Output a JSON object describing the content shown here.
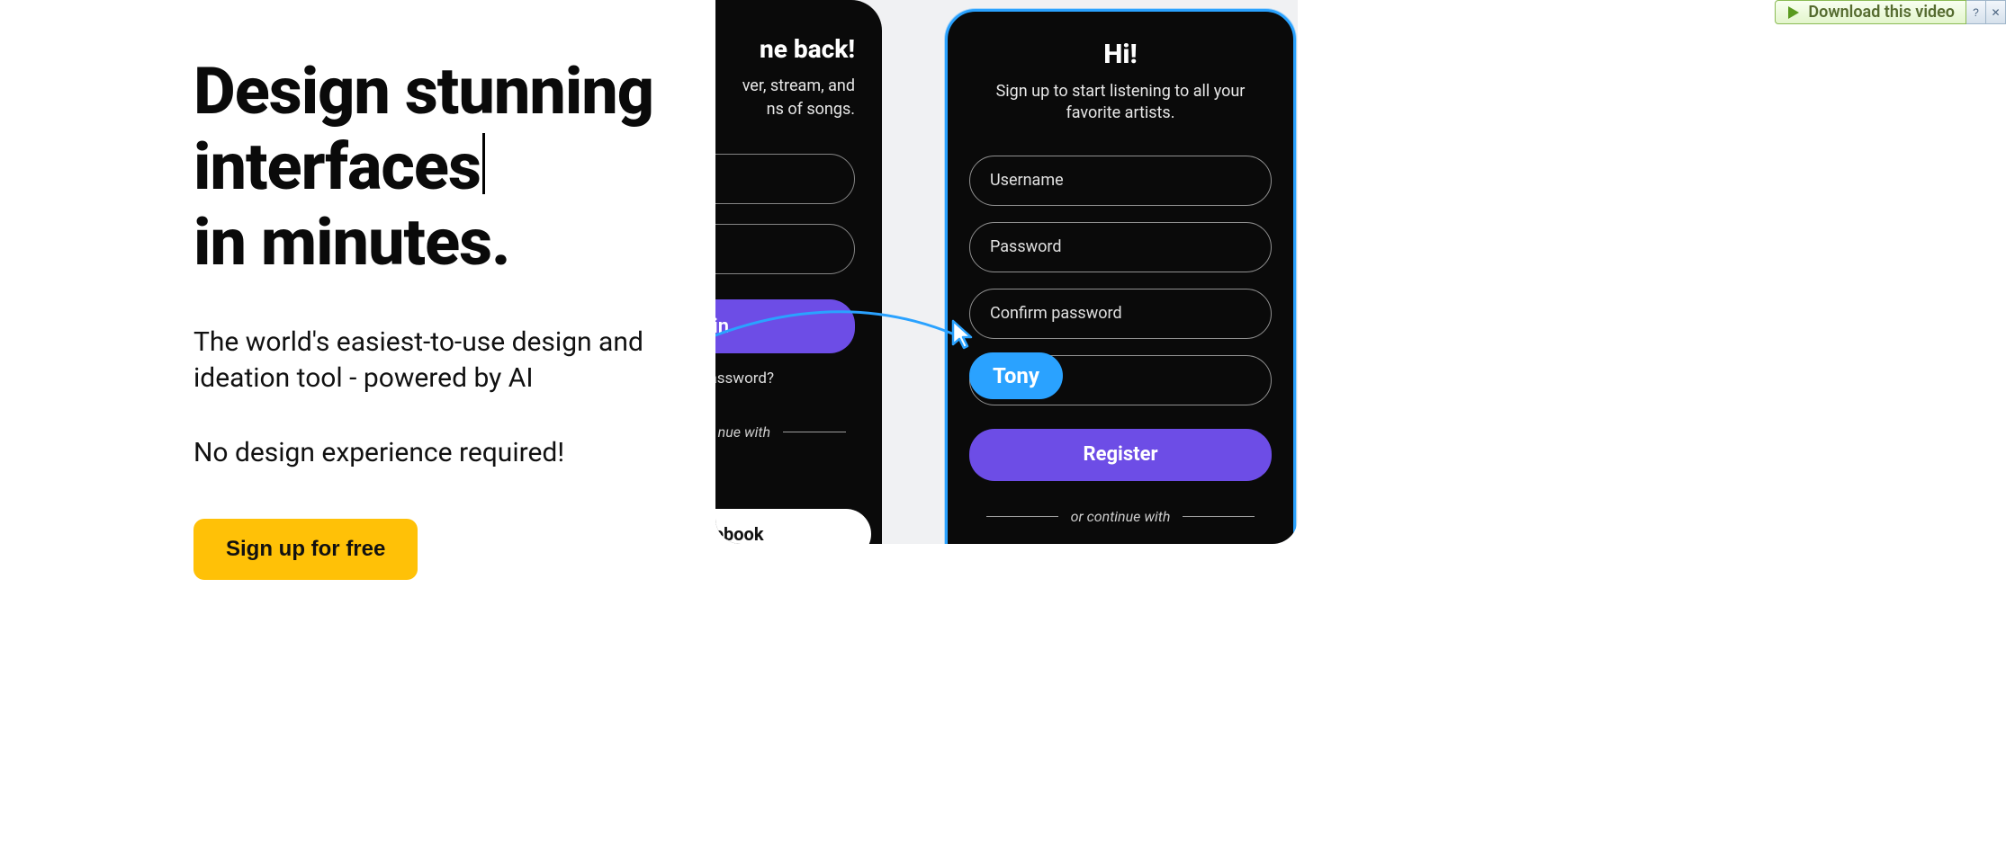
{
  "hero": {
    "headline_line1": "Design stunning",
    "headline_line2": "interfaces",
    "headline_line3": "in minutes.",
    "subhead": "The world's easiest-to-use design and ideation tool - powered by AI",
    "tagline": "No design experience required!",
    "cta": "Sign up for free"
  },
  "demo": {
    "left_phone": {
      "heading_fragment": "ne back!",
      "desc_line1_fragment": "ver, stream, and",
      "desc_line2_fragment": "ns of songs.",
      "signin_fragment": "n in",
      "forgot_fragment": "r password?",
      "continue_fragment": "nue with",
      "facebook": "Facebook"
    },
    "right_phone": {
      "heading": "Hi!",
      "desc": "Sign up to start listening to all your favorite artists.",
      "field_username": "Username",
      "field_password": "Password",
      "field_confirm": "Confirm password",
      "register": "Register",
      "continue": "or continue with"
    },
    "cursor_label": "Tony"
  },
  "ad_widget": {
    "label": "Download this video",
    "help": "?",
    "close": "✕"
  }
}
